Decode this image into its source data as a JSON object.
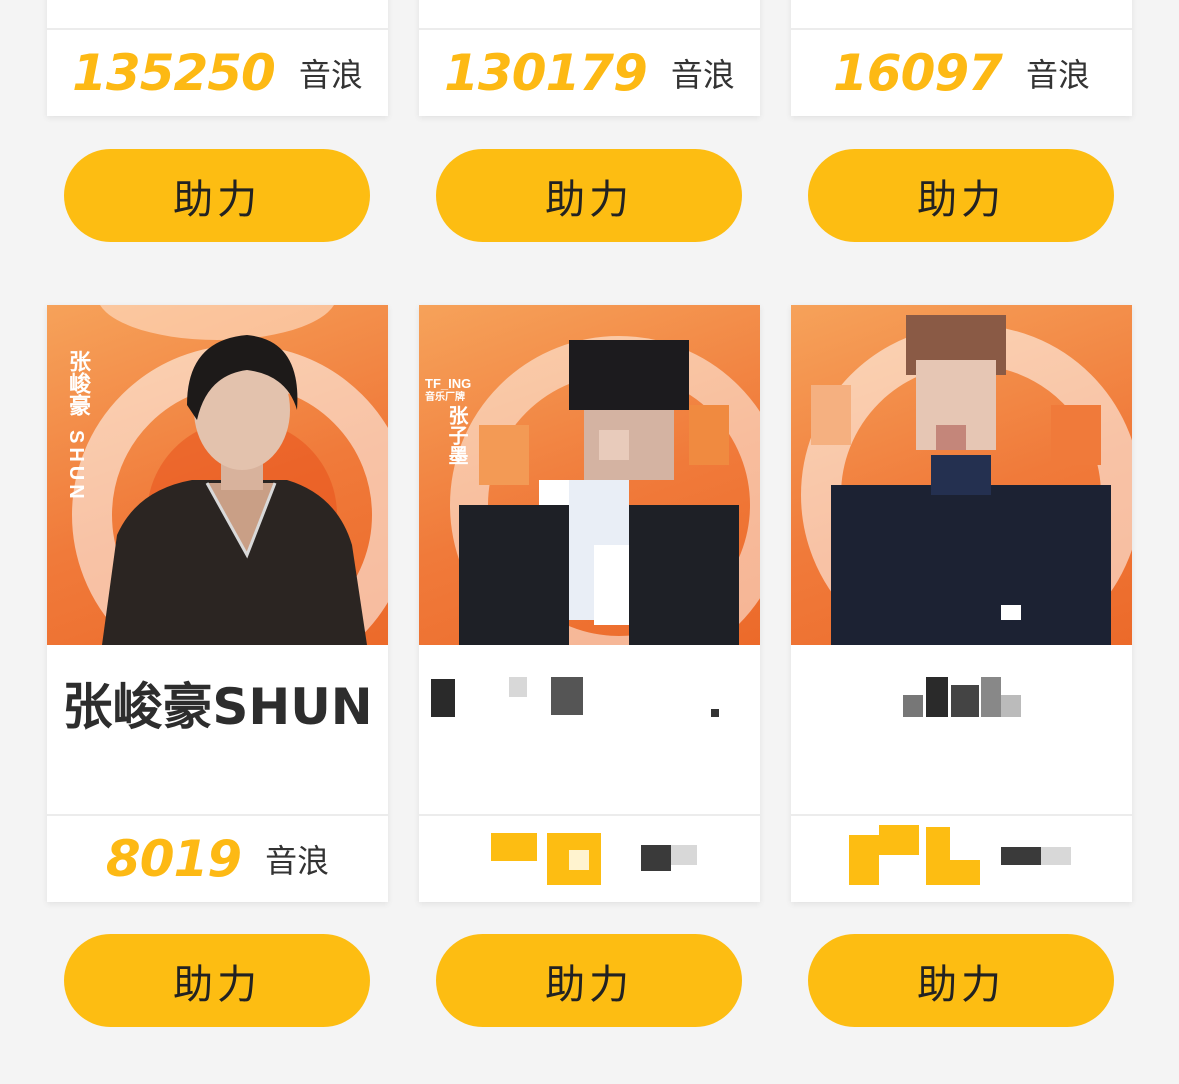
{
  "top_row": [
    {
      "score": "135250",
      "unit": "音浪",
      "button": "助力"
    },
    {
      "score": "130179",
      "unit": "音浪",
      "button": "助力"
    },
    {
      "score": "16097",
      "unit": "音浪",
      "button": "助力"
    }
  ],
  "bottom_row": [
    {
      "poster_name": "张峻豪",
      "poster_sub": "SHUN",
      "name": "张峻豪SHUN",
      "score": "8019",
      "unit": "音浪",
      "button": "助力"
    },
    {
      "poster_tag": "TF_ING",
      "poster_sub": "音乐厂牌",
      "poster_name": "张子墨",
      "name": "",
      "score": "",
      "unit": "",
      "button": "助力"
    },
    {
      "name": "",
      "score": "",
      "unit": "",
      "button": "助力"
    }
  ],
  "colors": {
    "accent": "#fdbd12",
    "score": "#fdb914",
    "poster": "#f07a3a",
    "background": "#f4f4f4"
  }
}
